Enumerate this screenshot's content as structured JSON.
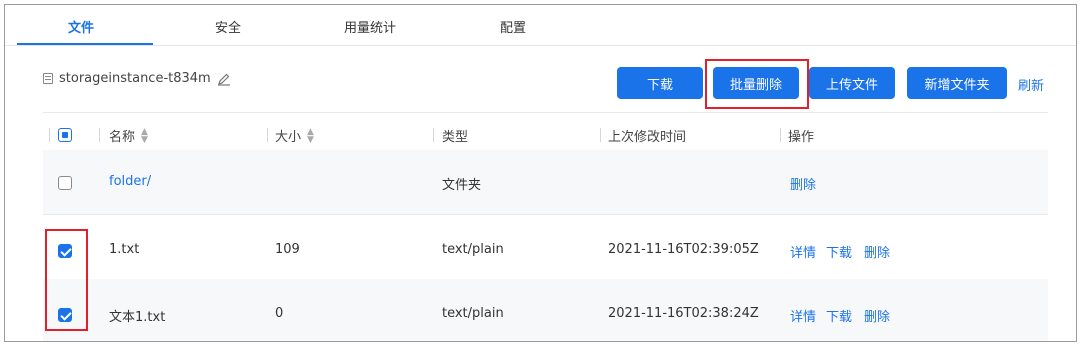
{
  "tabs": [
    {
      "label": "文件"
    },
    {
      "label": "安全"
    },
    {
      "label": "用量统计"
    },
    {
      "label": "配置"
    }
  ],
  "instance": {
    "name": "storageinstance-t834m"
  },
  "toolbar": {
    "download_label": "下载",
    "batch_delete_label": "批量删除",
    "upload_label": "上传文件",
    "new_folder_label": "新增文件夹",
    "refresh_label": "刷新"
  },
  "table": {
    "columns": [
      "名称",
      "大小",
      "类型",
      "上次修改时间",
      "操作"
    ],
    "rows": [
      {
        "name": "folder/",
        "size": "",
        "type": "文件夹",
        "modified": "",
        "checked": false,
        "actions": [
          "删除"
        ]
      },
      {
        "name": "1.txt",
        "size": "109",
        "type": "text/plain",
        "modified": "2021-11-16T02:39:05Z",
        "checked": true,
        "actions": [
          "详情",
          "下载",
          "删除"
        ]
      },
      {
        "name": "文本1.txt",
        "size": "0",
        "type": "text/plain",
        "modified": "2021-11-16T02:38:24Z",
        "checked": true,
        "actions": [
          "详情",
          "下载",
          "删除"
        ]
      }
    ]
  },
  "icons": {
    "instance": "database-icon",
    "edit": "pencil-icon",
    "sort": "sort-icon"
  },
  "colors": {
    "accent": "#1a73e8",
    "highlight": "#e0202a"
  }
}
